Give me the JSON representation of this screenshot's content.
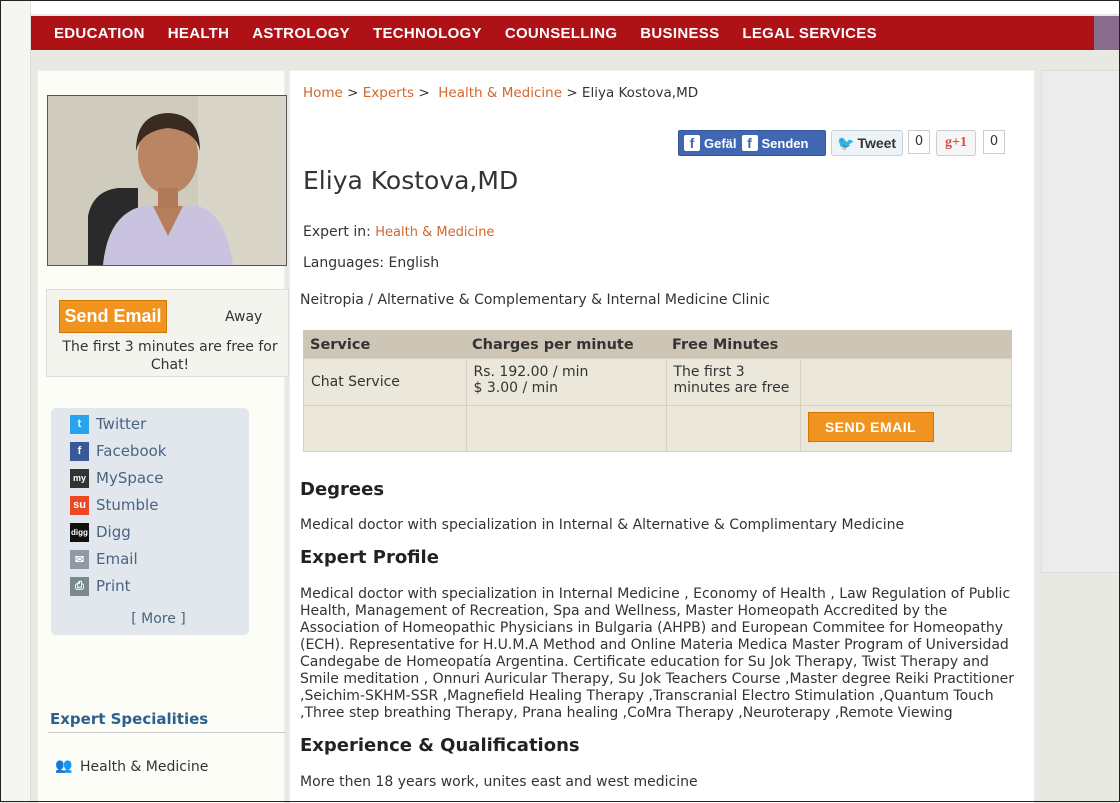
{
  "nav": [
    "EDUCATION",
    "HEALTH",
    "ASTROLOGY",
    "TECHNOLOGY",
    "COUNSELLING",
    "BUSINESS",
    "LEGAL SERVICES"
  ],
  "breadcrumb": {
    "home": "Home",
    "experts": "Experts",
    "category": "Health & Medicine",
    "current": "Eliya Kostova,MD",
    "sep": ">"
  },
  "social": {
    "fb_like": "Gefäl",
    "fb_send": "Senden",
    "tweet": "Tweet",
    "tweet_count": "0",
    "gplus": "+1",
    "gplus_count": "0"
  },
  "expert": {
    "name": "Eliya Kostova,MD",
    "expert_in_label": "Expert in:",
    "expert_in_value": "Health & Medicine",
    "languages": "Languages: English",
    "clinic": "Neitropia / Alternative & Complementary & Internal Medicine Clinic"
  },
  "contact": {
    "send_email": "Send Email",
    "status": "Away",
    "free_note": "The first 3 minutes are free for Chat!"
  },
  "share": {
    "items": [
      "Twitter",
      "Facebook",
      "MySpace",
      "Stumble",
      "Digg",
      "Email",
      "Print"
    ],
    "more": "[ More ]"
  },
  "specialities": {
    "title": "Expert Specialities",
    "items": [
      "Health & Medicine"
    ]
  },
  "service_table": {
    "headers": [
      "Service",
      "Charges per minute",
      "Free Minutes",
      ""
    ],
    "row": {
      "service": "Chat Service",
      "charge_rs": "Rs. 192.00 / min",
      "charge_usd": "$ 3.00 / min",
      "free": "The first 3 minutes are free"
    },
    "send_email": "SEND EMAIL"
  },
  "sections": {
    "degrees_title": "Degrees",
    "degrees_text": "Medical doctor with specialization in Internal & Alternative & Complimentary Medicine",
    "profile_title": "Expert Profile",
    "profile_text": "Medical doctor with specialization in Internal Medicine , Economy of Health , Law Regulation of Public Health, Management of Recreation, Spa and Wellness, Master Homeopath Accredited by the Association of Homeopathic Physicians in Bulgaria (AHPB) and European Commitee for Homeopathy (ECH). Representative for H.U.M.A Method and Online Materia Medica Master Program of Universidad Candegabe de Homeopatía Argentina. Certificate education for Su Jok Therapy, Twist Therapy and Smile meditation , Onnuri Auricular Therapy, Su Jok Teachers Course ,Master degree Reiki Practitioner ,Seichim-SKHM-SSR ,Magnefield Healing Therapy ,Transcranial Electro Stimulation ,Quantum Touch ,Three step breathing Therapy, Prana healing ,CoMra Therapy ,Neuroterapy ,Remote Viewing",
    "experience_title": "Experience & Qualifications",
    "experience_text": "More then 18 years work, unites east and west medicine"
  },
  "colors": {
    "nav_bg": "#ae1217",
    "accent_link": "#d1662e",
    "button_orange": "#f0931f",
    "share_text": "#4a6480"
  }
}
